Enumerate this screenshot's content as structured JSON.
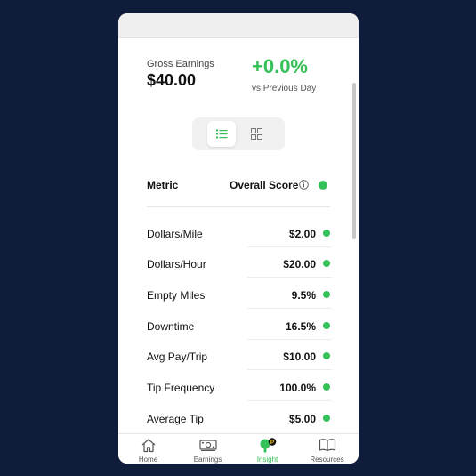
{
  "summary": {
    "earnings_label": "Gross Earnings",
    "earnings_value": "$40.00",
    "change_value": "+0.0%",
    "change_label": "vs Previous Day"
  },
  "view_toggle": {
    "list_icon": "list-icon",
    "grid_icon": "grid-icon",
    "selected": "list"
  },
  "table": {
    "header_metric": "Metric",
    "header_score": "Overall Score",
    "info_icon": "info-icon",
    "rows": [
      {
        "label": "Dollars/Mile",
        "value": "$2.00"
      },
      {
        "label": "Dollars/Hour",
        "value": "$20.00"
      },
      {
        "label": "Empty Miles",
        "value": "9.5%"
      },
      {
        "label": "Downtime",
        "value": "16.5%"
      },
      {
        "label": "Avg Pay/Trip",
        "value": "$10.00"
      },
      {
        "label": "Tip Frequency",
        "value": "100.0%"
      },
      {
        "label": "Average Tip",
        "value": "$5.00"
      }
    ]
  },
  "nav": [
    {
      "label": "Home",
      "icon": "home-icon"
    },
    {
      "label": "Earnings",
      "icon": "money-icon"
    },
    {
      "label": "Insight",
      "icon": "lightbulb-icon",
      "badge": "P",
      "active": true
    },
    {
      "label": "Resources",
      "icon": "book-icon"
    }
  ],
  "colors": {
    "background": "#0f1d3a",
    "accent": "#35c05a",
    "status_good": "#35c05a"
  }
}
